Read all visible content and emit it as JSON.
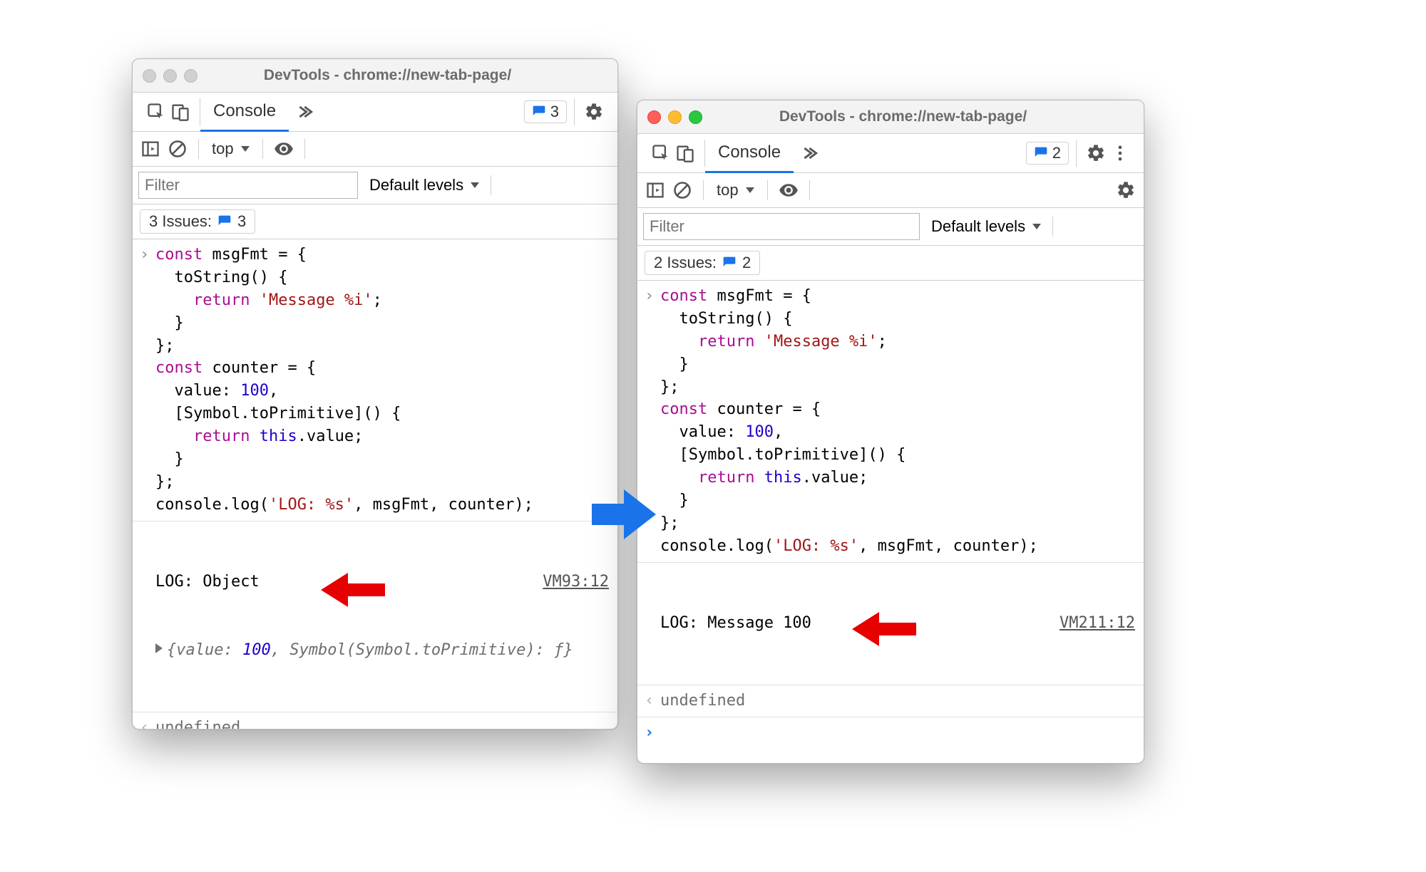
{
  "left": {
    "title": "DevTools - chrome://new-tab-page/",
    "tab": "Console",
    "badge_count": "3",
    "context": "top",
    "filter_placeholder": "Filter",
    "levels": "Default levels",
    "issues_label": "3 Issues:",
    "issues_count": "3",
    "srclink": "VM93:12",
    "log_output": "LOG: Object",
    "expand_preview_prefix": "{value: ",
    "expand_preview_num": "100",
    "expand_preview_mid": ", Symbol(Symbol.toPrimitive): ",
    "expand_preview_fn": "ƒ",
    "expand_preview_suffix": "}",
    "undefined": "undefined",
    "traffic_style": "grey"
  },
  "right": {
    "title": "DevTools - chrome://new-tab-page/",
    "tab": "Console",
    "badge_count": "2",
    "context": "top",
    "filter_placeholder": "Filter",
    "levels": "Default levels",
    "issues_label": "2 Issues:",
    "issues_count": "2",
    "srclink": "VM211:12",
    "log_output": "LOG: Message 100",
    "undefined": "undefined",
    "traffic_style": "color"
  },
  "code": {
    "l1a": "const",
    "l1b": " msgFmt = {",
    "l2": "  toString() {",
    "l3a": "    ",
    "l3b": "return",
    "l3c": " ",
    "l3d": "'Message %i'",
    "l3e": ";",
    "l4": "  }",
    "l5": "};",
    "l6a": "const",
    "l6b": " counter = {",
    "l7a": "  value: ",
    "l7b": "100",
    "l7c": ",",
    "l8": "  [Symbol.toPrimitive]() {",
    "l9a": "    ",
    "l9b": "return",
    "l9c": " ",
    "l9d": "this",
    "l9e": ".value;",
    "l10": "  }",
    "l11": "};",
    "l12a": "console.log(",
    "l12b": "'LOG: %s'",
    "l12c": ", msgFmt, counter);"
  }
}
